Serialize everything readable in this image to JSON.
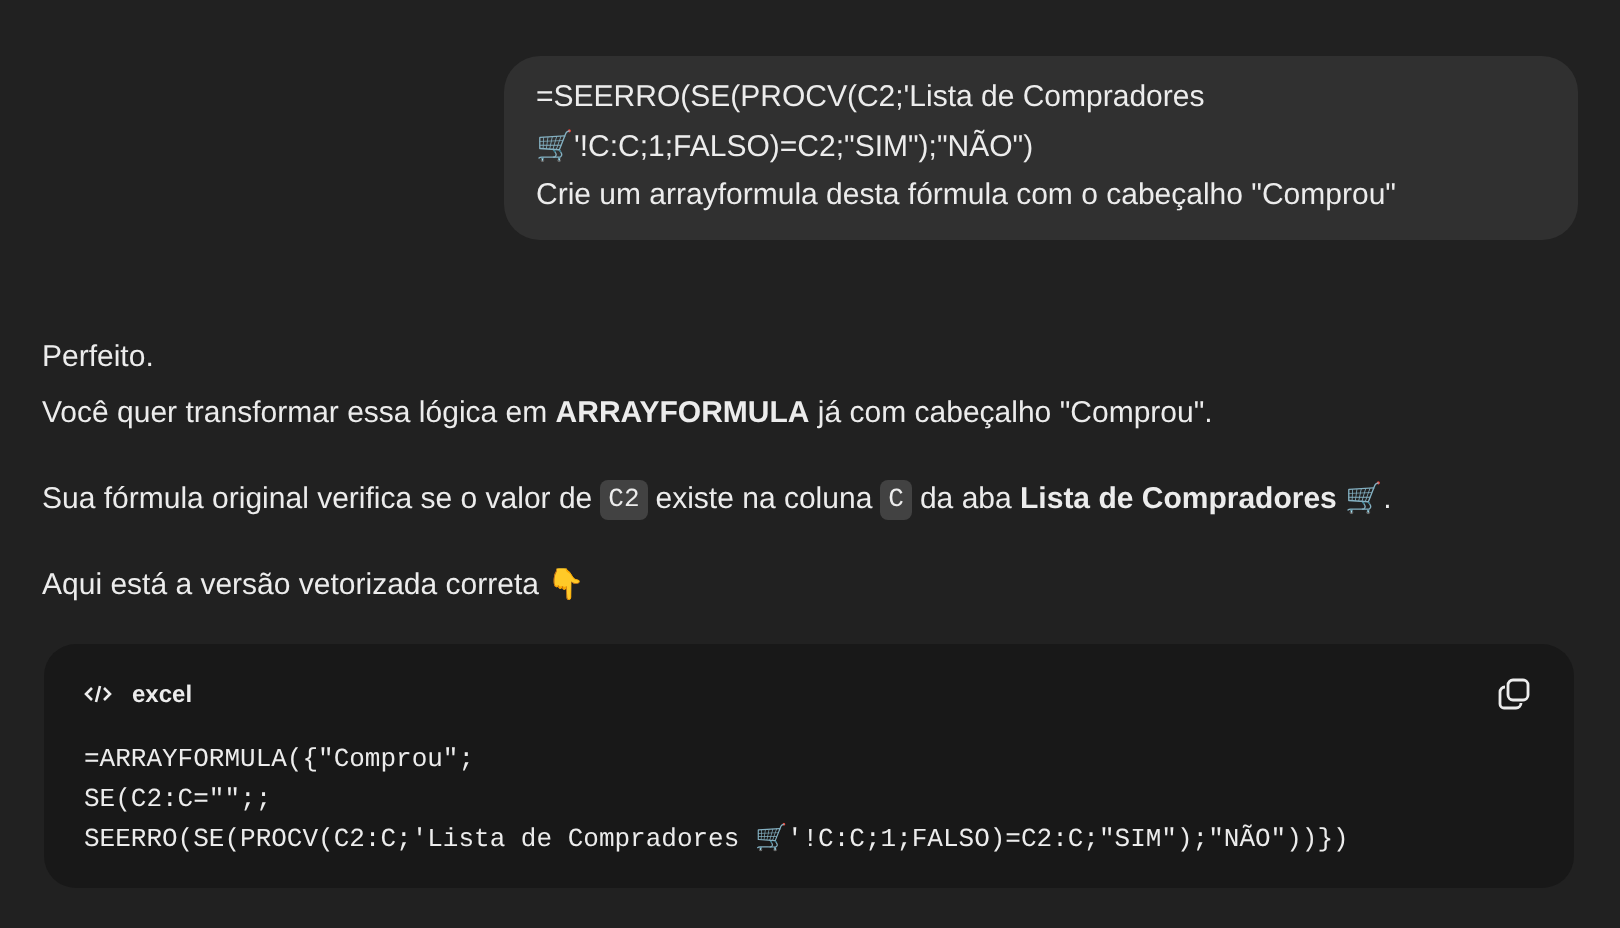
{
  "user_message": {
    "lines": [
      "=SEERRO(SE(PROCV(C2;'Lista de Compradores",
      "🛒'!C:C;1;FALSO)=C2;\"SIM\");\"NÃO\")",
      "Crie um arrayformula desta fórmula com o cabeçalho \"Comprou\""
    ]
  },
  "assistant_message": {
    "paragraphs": [
      {
        "lines": [
          [
            {
              "kind": "text",
              "text": "Perfeito."
            }
          ],
          [
            {
              "kind": "text",
              "text": "Você quer transformar essa lógica em **ARRAYFORMULA** já com cabeçalho \"Comprou\"."
            }
          ]
        ]
      },
      {
        "lines": [
          [
            {
              "kind": "text",
              "text": "Sua fórmula original verifica se o valor de"
            },
            {
              "kind": "code",
              "text": "C2"
            },
            {
              "kind": "text",
              "text": "existe na coluna"
            },
            {
              "kind": "code",
              "text": "C"
            },
            {
              "kind": "text",
              "text": "da aba **Lista de Compradores 🛒**."
            }
          ]
        ]
      },
      {
        "lines": [
          [
            {
              "kind": "text",
              "text": "Aqui está a versão vetorizada correta 👇"
            }
          ]
        ]
      }
    ]
  },
  "code_block": {
    "language": "excel",
    "lines": [
      "=ARRAYFORMULA({\"Comprou\";",
      "SE(C2:C=\"\";;",
      "SEERRO(SE(PROCV(C2:C;'Lista de Compradores 🛒'!C:C;1;FALSO)=C2:C;\"SIM\");\"NÃO\"))})"
    ]
  }
}
